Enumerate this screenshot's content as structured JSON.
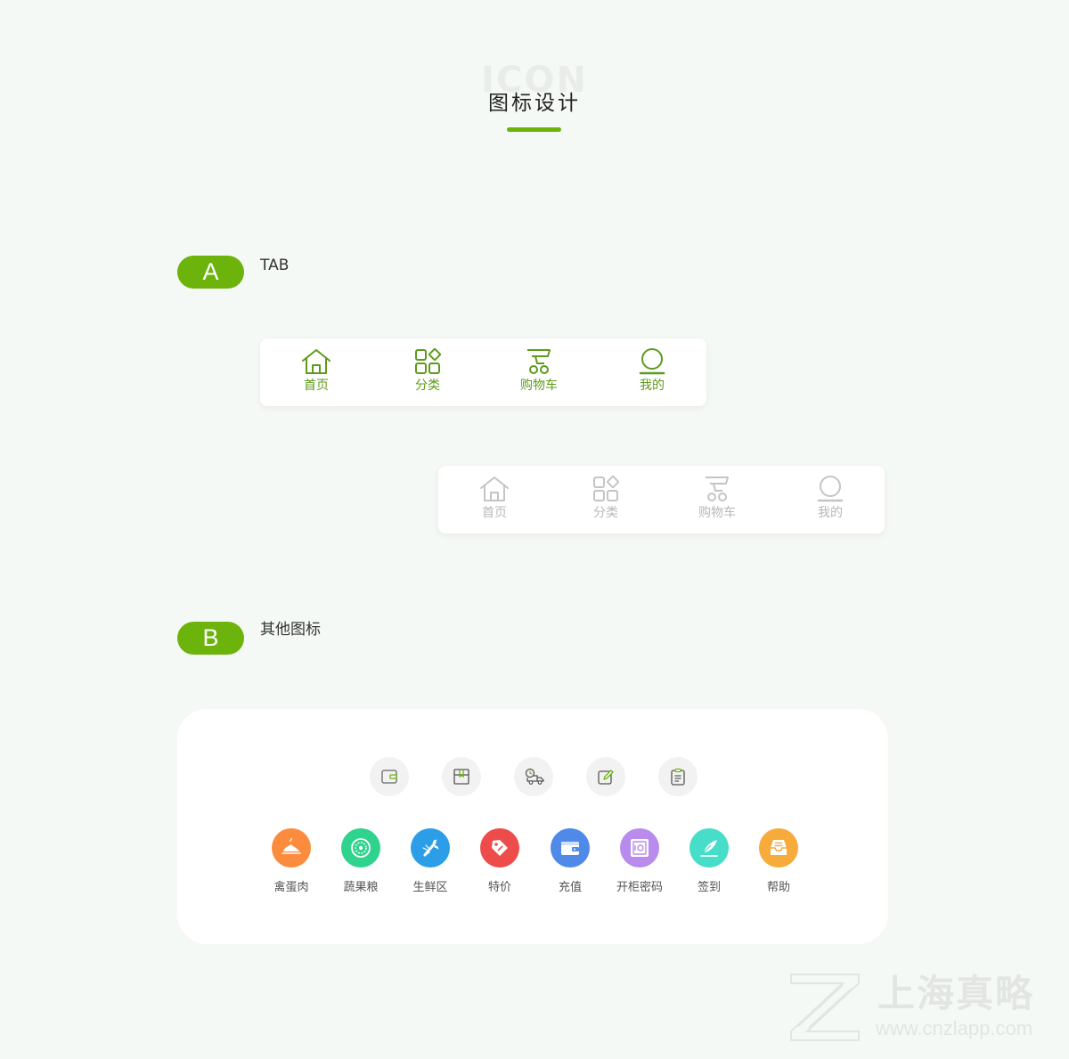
{
  "header": {
    "background_word": "ICON",
    "title": "图标设计",
    "accent_color": "#6cb30c"
  },
  "section_a": {
    "badge": "A",
    "label": "TAB"
  },
  "tabbar_active": {
    "items": [
      {
        "label": "首页",
        "icon": "home-icon"
      },
      {
        "label": "分类",
        "icon": "category-icon"
      },
      {
        "label": "购物车",
        "icon": "cart-icon"
      },
      {
        "label": "我的",
        "icon": "user-icon"
      }
    ],
    "color": "#5e9a1c"
  },
  "tabbar_inactive": {
    "items": [
      {
        "label": "首页",
        "icon": "home-icon"
      },
      {
        "label": "分类",
        "icon": "category-icon"
      },
      {
        "label": "购物车",
        "icon": "cart-icon"
      },
      {
        "label": "我的",
        "icon": "user-icon"
      }
    ],
    "color": "#b8b8b8"
  },
  "section_b": {
    "badge": "B",
    "label": "其他图标"
  },
  "small_icons": [
    "wallet-icon",
    "package-icon",
    "delivery-truck-icon",
    "edit-icon",
    "clipboard-icon"
  ],
  "categories": [
    {
      "label": "禽蛋肉",
      "icon": "meat-icon",
      "color": "#fb8c3e"
    },
    {
      "label": "蔬果粮",
      "icon": "vegetable-icon",
      "color": "#2fd38d"
    },
    {
      "label": "生鲜区",
      "icon": "lobster-icon",
      "color": "#2c9ee8"
    },
    {
      "label": "特价",
      "icon": "price-tag-icon",
      "color": "#ee4b4b"
    },
    {
      "label": "充值",
      "icon": "wallet-icon",
      "color": "#4f8ae9"
    },
    {
      "label": "开柜密码",
      "icon": "safe-icon",
      "color": "#b98bec"
    },
    {
      "label": "签到",
      "icon": "quill-icon",
      "color": "#46ddc9"
    },
    {
      "label": "帮助",
      "icon": "inbox-icon",
      "color": "#f7ab3b"
    }
  ],
  "watermark": {
    "name": "上海真略",
    "url": "www.cnzlapp.com"
  }
}
